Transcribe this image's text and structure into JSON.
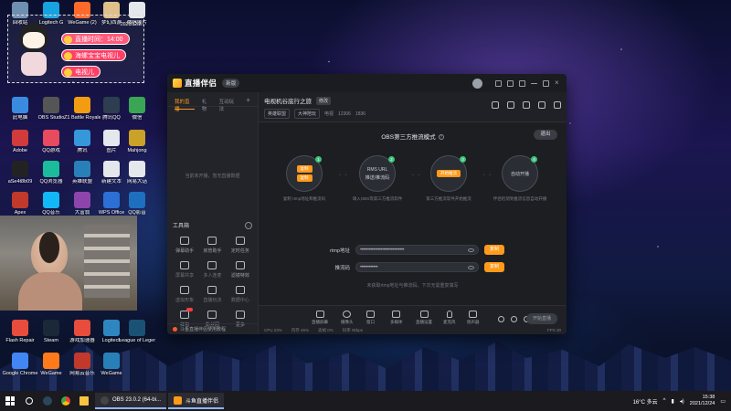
{
  "desktop": {
    "icons_top": [
      "Logitech G",
      "WeGame (2)",
      "梦幻西游",
      "微信图片"
    ],
    "icons_col1": [
      "回收站",
      "此电脑",
      "Adobe",
      "QQ影音",
      "aSe4t8b09",
      "Apex",
      "Flash Repair",
      "Google Chrome"
    ],
    "icons_col2": [
      "Logitech",
      "OBS Studio",
      "QQ游戏",
      "QQ音乐",
      "QQ浏览器",
      "Steam",
      "WeGame"
    ],
    "icons_col3": [
      "WeGame",
      "Z1 Battle Royale",
      "腾讯",
      "英雄联盟",
      "大富翁",
      "游戏加速器",
      "网易云音乐",
      "WPS Office"
    ],
    "icons_col4": [
      "新建文本",
      "微信",
      "腾讯QQ",
      "图片",
      "Mahjong",
      "网易大话",
      "League of Legends"
    ],
    "right_text": "2021/12/2..."
  },
  "overlay": {
    "pill1": "直播时间：14:00",
    "pill2": "海螺宝宝电视儿",
    "pill3": "电视儿"
  },
  "app": {
    "logo": "直播伴侣",
    "version": "新版",
    "left_tabs": [
      "我的直播",
      "礼物",
      "互动玩法"
    ],
    "left_empty": "当前未开播，暂无直播数据",
    "tools_title": "工具箱",
    "tools": [
      {
        "label": "弹幕助手"
      },
      {
        "label": "房管助手"
      },
      {
        "label": "定时任务"
      },
      {
        "label": "屏幕共享"
      },
      {
        "label": "多人连麦"
      },
      {
        "label": "滤镜特效"
      },
      {
        "label": "虚拟形象"
      },
      {
        "label": "直播玩法"
      },
      {
        "label": "数据中心"
      },
      {
        "label": "红包"
      },
      {
        "label": "粉丝团"
      },
      {
        "label": "更多"
      }
    ],
    "left_footer": "斗鱼直播伴侣使用教程",
    "room": {
      "title": "电视机谷底行之旅",
      "tag": "修改",
      "category": "英雄联盟",
      "sub": "大神陪玩",
      "meta_label": "电视",
      "meta_value": "12306",
      "fans": "1836"
    },
    "mode_title": "OBS第三方推流模式",
    "exit": "退出",
    "steps": [
      {
        "num": "1",
        "btn1": "复制",
        "btn2": "复制",
        "cap": "复制 rtmp地址和推流码"
      },
      {
        "num": "2",
        "line1": "RMS URL",
        "line2": "推送/推流码",
        "cap": "填入OBS等第三方推流软件"
      },
      {
        "num": "3",
        "btn1": "开始推流",
        "cap": "第三方推流软件开始推流"
      },
      {
        "num": "4",
        "line1": "自动开播",
        "cap": "伴侣检测到推流信息自动开播"
      }
    ],
    "rtmp_label": "rtmp地址",
    "rtmp_value": "••••••••••••••••••••••••••••••",
    "key_label": "推流码",
    "key_value": "••••••••••••",
    "copy": "复制",
    "hint": "未获取rtmp地址与推流码，下次无需重复填写",
    "bottom": [
      "直播屏幕",
      "摄像头",
      "窗口",
      "多媒体",
      "直播设置",
      "麦克风",
      "扬声器"
    ],
    "start_live": "开始直播",
    "status_left": [
      "CPU 23%",
      "内存 45%",
      "丢帧 0%",
      "码率 0kbps"
    ],
    "status_right": "FPS 30"
  },
  "taskbar": {
    "task1": "OBS 23.0.2 (64-bi...",
    "task2": "斗鱼直播伴侣",
    "weather": "16°C 多云",
    "time": "15:38",
    "date": "2021/12/24"
  }
}
